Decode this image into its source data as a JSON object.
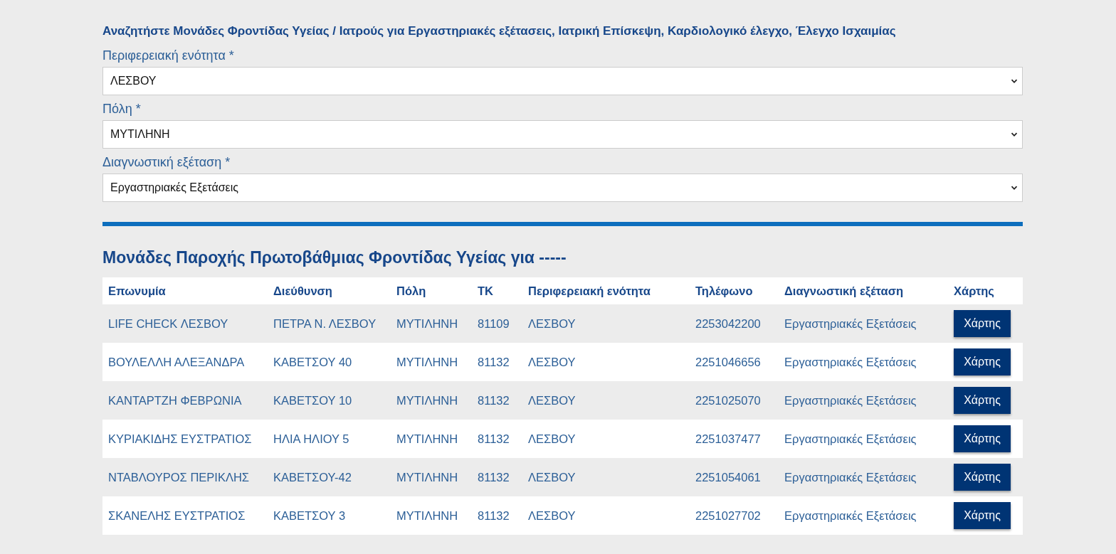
{
  "search_title": "Αναζητήστε Μονάδες Φροντίδας Υγείας / Ιατρούς για Εργαστηριακές εξέτασεις, Ιατρική Επίσκεψη, Καρδιολογικό έλεγχο, Έλεγχο Ισχαιμίας",
  "filters": [
    {
      "label": "Περιφερειακή ενότητα *",
      "value": "ΛΕΣΒΟΥ"
    },
    {
      "label": "Πόλη *",
      "value": "ΜΥΤΙΛΗΝΗ"
    },
    {
      "label": "Διαγνωστική εξέταση *",
      "value": "Εργαστηριακές Εξετάσεις"
    }
  ],
  "results_title": "Μονάδες Παροχής Πρωτοβάθμιας Φροντίδας Υγείας για -----",
  "table": {
    "columns": [
      "Επωνυμία",
      "Διεύθυνση",
      "Πόλη",
      "ΤΚ",
      "Περιφερειακή ενότητα",
      "Τηλέφωνο",
      "Διαγνωστική εξέταση",
      "Χάρτης"
    ],
    "rows": [
      {
        "cells": [
          "LIFE CHECK ΛΕΣΒΟΥ",
          "ΠΕΤΡΑ Ν. ΛΕΣΒΟΥ",
          "ΜΥΤΙΛΗΝΗ",
          "81109",
          "ΛΕΣΒΟΥ",
          "2253042200",
          "Εργαστηριακές Εξετάσεις"
        ],
        "button": "Χάρτης"
      },
      {
        "cells": [
          "ΒΟΥΛΕΛΛΗ ΑΛΕΞΑΝΔΡΑ",
          "ΚΑΒΕΤΣΟΥ 40",
          "ΜΥΤΙΛΗΝΗ",
          "81132",
          "ΛΕΣΒΟΥ",
          "2251046656",
          "Εργαστηριακές Εξετάσεις"
        ],
        "button": "Χάρτης"
      },
      {
        "cells": [
          "ΚΑΝΤΑΡΤΖΗ ΦΕΒΡΩΝΙΑ",
          "ΚΑΒΕΤΣΟΥ 10",
          "ΜΥΤΙΛΗΝΗ",
          "81132",
          "ΛΕΣΒΟΥ",
          "2251025070",
          "Εργαστηριακές Εξετάσεις"
        ],
        "button": "Χάρτης"
      },
      {
        "cells": [
          "ΚΥΡΙΑΚΙΔΗΣ ΕΥΣΤΡΑΤΙΟΣ",
          "ΗΛΙΑ ΗΛΙΟΥ 5",
          "ΜΥΤΙΛΗΝΗ",
          "81132",
          "ΛΕΣΒΟΥ",
          "2251037477",
          "Εργαστηριακές Εξετάσεις"
        ],
        "button": "Χάρτης"
      },
      {
        "cells": [
          "ΝΤΑΒΛΟΥΡΟΣ ΠΕΡΙΚΛΗΣ",
          "ΚΑΒΕΤΣΟΥ-42",
          "ΜΥΤΙΛΗΝΗ",
          "81132",
          "ΛΕΣΒΟΥ",
          "2251054061",
          "Εργαστηριακές Εξετάσεις"
        ],
        "button": "Χάρτης"
      },
      {
        "cells": [
          "ΣΚΑΝΕΛΗΣ ΕΥΣΤΡΑΤΙΟΣ",
          "ΚΑΒΕΤΣΟΥ 3",
          "ΜΥΤΙΛΗΝΗ",
          "81132",
          "ΛΕΣΒΟΥ",
          "2251027702",
          "Εργαστηριακές Εξετάσεις"
        ],
        "button": "Χάρτης"
      }
    ]
  }
}
